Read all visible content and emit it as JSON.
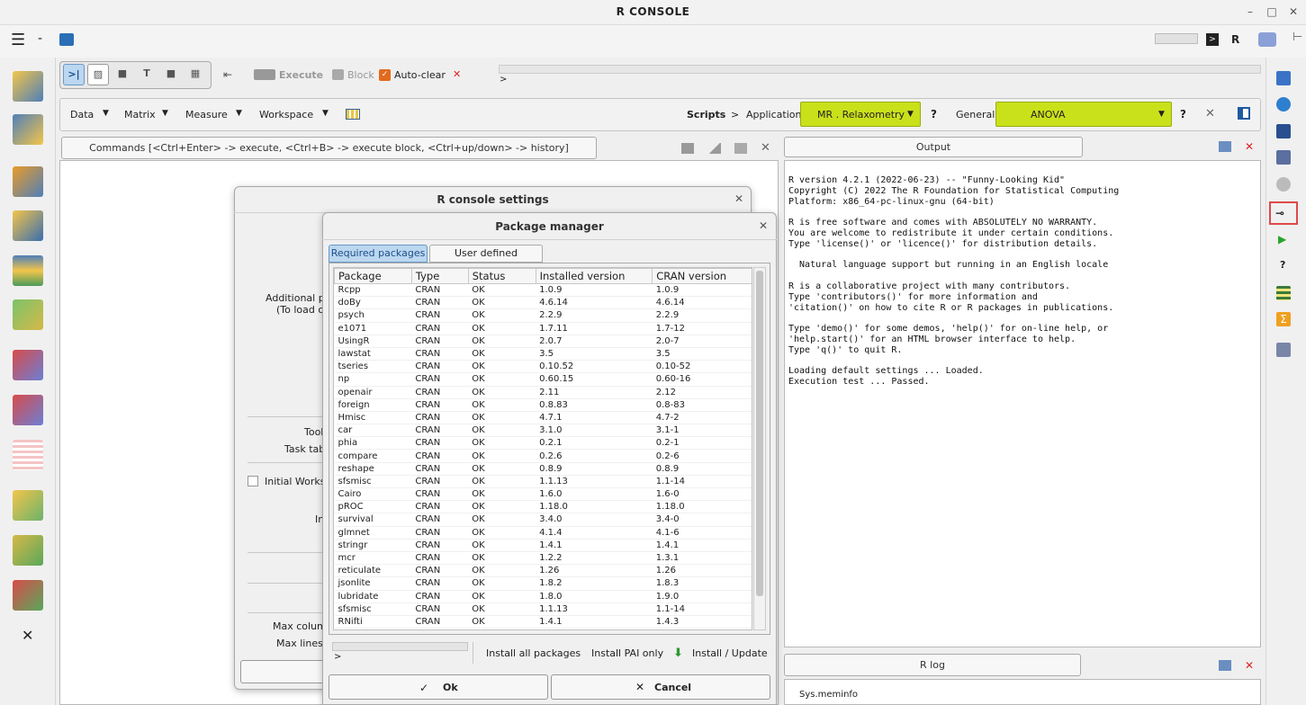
{
  "window": {
    "title": "R CONSOLE"
  },
  "toolbar": {
    "execute_label": "Execute",
    "block_label": "Block",
    "autoclear_label": "Auto-clear",
    "console_prompt": ">"
  },
  "menus": [
    "Data",
    "Matrix",
    "Measure",
    "Workspace"
  ],
  "scripts": {
    "label": "Scripts",
    "sep": ">",
    "app_label": "Application",
    "app_value": "MR . Relaxometry",
    "help": "?",
    "general_label": "General",
    "general_value": "ANOVA"
  },
  "commands": {
    "header": "Commands   [<Ctrl+Enter> -> execute, <Ctrl+B> -> execute block, <Ctrl+up/down> -> history]"
  },
  "output": {
    "header": "Output",
    "text": "R version 4.2.1 (2022-06-23) -- \"Funny-Looking Kid\"\nCopyright (C) 2022 The R Foundation for Statistical Computing\nPlatform: x86_64-pc-linux-gnu (64-bit)\n\nR is free software and comes with ABSOLUTELY NO WARRANTY.\nYou are welcome to redistribute it under certain conditions.\nType 'license()' or 'licence()' for distribution details.\n\n  Natural language support but running in an English locale\n\nR is a collaborative project with many contributors.\nType 'contributors()' for more information and\n'citation()' on how to cite R or R packages in publications.\n\nType 'demo()' for some demos, 'help()' for on-line help, or\n'help.start()' for an HTML browser interface to help.\nType 'q()' to quit R.\n\nLoading default settings ... Loaded.\nExecution test ... Passed."
  },
  "rlog": {
    "header": "R log",
    "text": "Sys.meminfo"
  },
  "settings": {
    "title": "R console settings",
    "additional_label": "Additional pa",
    "additional_label2": "(To load or",
    "tool_label": "Tool",
    "tasktab_label": "Task tab",
    "initial_workspace": "Initial Worksp",
    "in_label": "In",
    "max_columns": "Max column",
    "max_lines": "Max lines i"
  },
  "pkgmgr": {
    "title": "Package manager",
    "tabs": [
      "Required packages",
      "User defined packages"
    ],
    "columns": [
      "Package",
      "Type",
      "Status",
      "Installed version",
      "CRAN version"
    ],
    "rows": [
      [
        "Rcpp",
        "CRAN",
        "OK",
        "1.0.9",
        "1.0.9"
      ],
      [
        "doBy",
        "CRAN",
        "OK",
        "4.6.14",
        "4.6.14"
      ],
      [
        "psych",
        "CRAN",
        "OK",
        "2.2.9",
        "2.2.9"
      ],
      [
        "e1071",
        "CRAN",
        "OK",
        "1.7.11",
        "1.7-12"
      ],
      [
        "UsingR",
        "CRAN",
        "OK",
        "2.0.7",
        "2.0-7"
      ],
      [
        "lawstat",
        "CRAN",
        "OK",
        "3.5",
        "3.5"
      ],
      [
        "tseries",
        "CRAN",
        "OK",
        "0.10.52",
        "0.10-52"
      ],
      [
        "np",
        "CRAN",
        "OK",
        "0.60.15",
        "0.60-16"
      ],
      [
        "openair",
        "CRAN",
        "OK",
        "2.11",
        "2.12"
      ],
      [
        "foreign",
        "CRAN",
        "OK",
        "0.8.83",
        "0.8-83"
      ],
      [
        "Hmisc",
        "CRAN",
        "OK",
        "4.7.1",
        "4.7-2"
      ],
      [
        "car",
        "CRAN",
        "OK",
        "3.1.0",
        "3.1-1"
      ],
      [
        "phia",
        "CRAN",
        "OK",
        "0.2.1",
        "0.2-1"
      ],
      [
        "compare",
        "CRAN",
        "OK",
        "0.2.6",
        "0.2-6"
      ],
      [
        "reshape",
        "CRAN",
        "OK",
        "0.8.9",
        "0.8.9"
      ],
      [
        "sfsmisc",
        "CRAN",
        "OK",
        "1.1.13",
        "1.1-14"
      ],
      [
        "Cairo",
        "CRAN",
        "OK",
        "1.6.0",
        "1.6-0"
      ],
      [
        "pROC",
        "CRAN",
        "OK",
        "1.18.0",
        "1.18.0"
      ],
      [
        "survival",
        "CRAN",
        "OK",
        "3.4.0",
        "3.4-0"
      ],
      [
        "glmnet",
        "CRAN",
        "OK",
        "4.1.4",
        "4.1-6"
      ],
      [
        "stringr",
        "CRAN",
        "OK",
        "1.4.1",
        "1.4.1"
      ],
      [
        "mcr",
        "CRAN",
        "OK",
        "1.2.2",
        "1.3.1"
      ],
      [
        "reticulate",
        "CRAN",
        "OK",
        "1.26",
        "1.26"
      ],
      [
        "jsonlite",
        "CRAN",
        "OK",
        "1.8.2",
        "1.8.3"
      ],
      [
        "lubridate",
        "CRAN",
        "OK",
        "1.8.0",
        "1.9.0"
      ],
      [
        "sfsmisc",
        "CRAN",
        "OK",
        "1.1.13",
        "1.1-14"
      ],
      [
        "RNifti",
        "CRAN",
        "OK",
        "1.4.1",
        "1.4.3"
      ]
    ],
    "prompt": ">",
    "install_all": "Install all packages",
    "install_pai": "Install PAI only",
    "install_update": "Install / Update",
    "ok": "Ok",
    "cancel": "Cancel"
  },
  "colors": {
    "accent_green": "#c9e11a",
    "selected_tab": "#bcd7f0",
    "close_red": "#dd2222"
  }
}
